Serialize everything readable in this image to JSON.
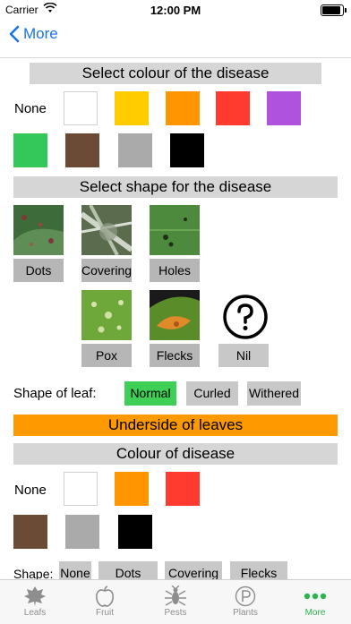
{
  "status_bar": {
    "carrier": "Carrier",
    "time": "12:00 PM"
  },
  "nav": {
    "back_label": "More"
  },
  "colour_section": {
    "title": "Select colour of the disease",
    "none_label": "None",
    "swatches": [
      "#ffffff",
      "#ffcc00",
      "#ff9500",
      "#ff3b30",
      "#af52de",
      "#34c759",
      "#6b4a36",
      "#aaaaaa",
      "#000000"
    ]
  },
  "shape_section": {
    "title": "Select shape for the disease",
    "shapes": [
      {
        "label": "Dots",
        "icon": "dots-leaf-photo"
      },
      {
        "label": "Covering",
        "icon": "covering-leaf-photo"
      },
      {
        "label": "Holes",
        "icon": "holes-leaf-photo"
      },
      {
        "label": "Pox",
        "icon": "pox-leaf-photo"
      },
      {
        "label": "Flecks",
        "icon": "flecks-leaf-photo"
      },
      {
        "label": "Nil",
        "icon": "question-circle-icon"
      }
    ]
  },
  "leaf_shape": {
    "label": "Shape of leaf:",
    "options": [
      "Normal",
      "Curled",
      "Withered"
    ],
    "selected": "Normal"
  },
  "underside": {
    "title": "Underside of leaves",
    "colour_title": "Colour of disease",
    "none_label": "None",
    "swatches": [
      "#ffffff",
      "#ff9500",
      "#ff3b30",
      "#6b4a36",
      "#aaaaaa",
      "#000000"
    ],
    "shape_label": "Shape:",
    "shape_options": [
      "None",
      "Dots",
      "Covering",
      "Flecks"
    ]
  },
  "tabs": [
    {
      "label": "Leafs",
      "icon": "leaf-icon"
    },
    {
      "label": "Fruit",
      "icon": "apple-icon"
    },
    {
      "label": "Pests",
      "icon": "bug-icon"
    },
    {
      "label": "Plants",
      "icon": "plant-p-icon"
    },
    {
      "label": "More",
      "icon": "more-dots-icon",
      "active": true
    }
  ],
  "colors": {
    "accent": "#1a73e8",
    "tab_active": "#2eb34e",
    "selected": "#3fcf57",
    "orange_header": "#ff9900"
  }
}
